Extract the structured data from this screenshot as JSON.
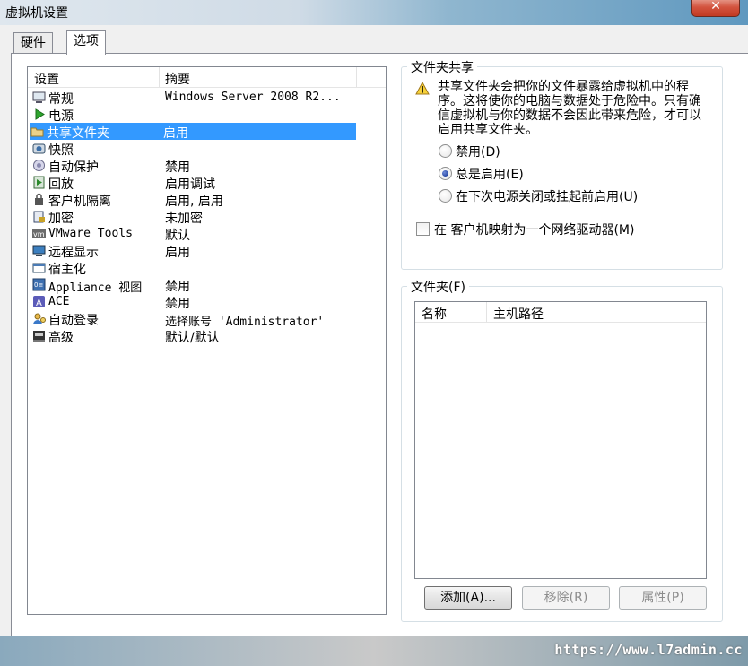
{
  "window": {
    "title": "虚拟机设置",
    "close_glyph": "✕"
  },
  "tabs": [
    {
      "label": "硬件"
    },
    {
      "label": "选项"
    }
  ],
  "settings_list": {
    "columns": [
      "设置",
      "摘要"
    ],
    "rows": [
      {
        "name": "常规",
        "summary": "Windows Server 2008 R2...",
        "icon": "computer-icon"
      },
      {
        "name": "电源",
        "summary": "",
        "icon": "power-play-icon"
      },
      {
        "name": "共享文件夹",
        "summary": "启用",
        "icon": "shared-folder-icon",
        "selected": true
      },
      {
        "name": "快照",
        "summary": "",
        "icon": "snapshot-icon"
      },
      {
        "name": "自动保护",
        "summary": "禁用",
        "icon": "autoprotect-icon"
      },
      {
        "name": "回放",
        "summary": "启用调试",
        "icon": "replay-icon"
      },
      {
        "name": "客户机隔离",
        "summary": "启用, 启用",
        "icon": "lock-icon"
      },
      {
        "name": "加密",
        "summary": "未加密",
        "icon": "encryption-icon"
      },
      {
        "name": "VMware Tools",
        "summary": "默认",
        "icon": "vmware-tools-icon"
      },
      {
        "name": "远程显示",
        "summary": "启用",
        "icon": "remote-display-icon"
      },
      {
        "name": "宿主化",
        "summary": "",
        "icon": "unity-icon"
      },
      {
        "name": "Appliance 视图",
        "summary": "禁用",
        "icon": "appliance-icon"
      },
      {
        "name": "ACE",
        "summary": "禁用",
        "icon": "ace-icon"
      },
      {
        "name": "自动登录",
        "summary": "选择账号 'Administrator'",
        "icon": "autologon-icon"
      },
      {
        "name": "高级",
        "summary": "默认/默认",
        "icon": "advanced-icon"
      }
    ]
  },
  "shared_folders": {
    "title": "文件夹共享",
    "warning": "共享文件夹会把你的文件暴露给虚拟机中的程序。这将使你的电脑与数据处于危险中。只有确信虚拟机与你的数据不会因此带来危险，才可以启用共享文件夹。",
    "options": [
      {
        "label": "禁用(D)",
        "checked": false
      },
      {
        "label": "总是启用(E)",
        "checked": true
      },
      {
        "label": "在下次电源关闭或挂起前启用(U)",
        "checked": false
      }
    ],
    "map_drive_label": "在 客户机映射为一个网络驱动器(M)",
    "map_drive_checked": false
  },
  "folders": {
    "title": "文件夹(F)",
    "columns": [
      "名称",
      "主机路径"
    ],
    "buttons": {
      "add": "添加(A)...",
      "remove": "移除(R)",
      "properties": "属性(P)"
    }
  },
  "watermark": "https://www.l7admin.cc",
  "colors": {
    "selection": "#3399ff",
    "accent": "#d3533e"
  }
}
